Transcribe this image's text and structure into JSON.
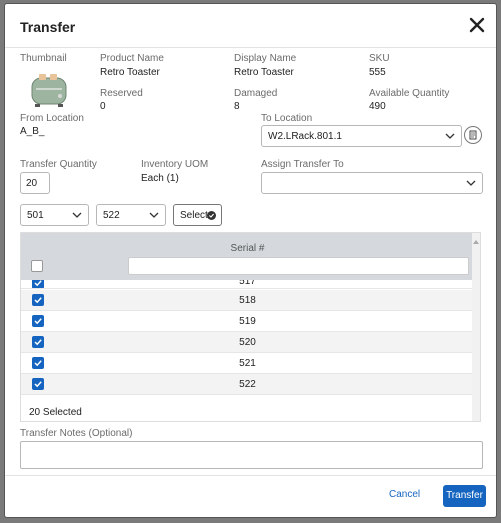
{
  "modal": {
    "title": "Transfer"
  },
  "product": {
    "thumbnail_label": "Thumbnail",
    "product_name_label": "Product Name",
    "product_name": "Retro Toaster",
    "display_name_label": "Display Name",
    "display_name": "Retro Toaster",
    "sku_label": "SKU",
    "sku": "555",
    "reserved_label": "Reserved",
    "reserved": "0",
    "damaged_label": "Damaged",
    "damaged": "8",
    "available_label": "Available Quantity",
    "available": "490"
  },
  "transfer": {
    "from_label": "From Location",
    "from_value": "A_B_",
    "to_label": "To Location",
    "to_value": "W2.LRack.801.1",
    "qty_label": "Transfer Quantity",
    "qty_value": "20",
    "uom_label": "Inventory UOM",
    "uom_value": "Each (1)",
    "assign_label": "Assign Transfer To",
    "assign_value": ""
  },
  "range": {
    "start": "501",
    "end": "522",
    "select_label": "Select"
  },
  "table": {
    "header_serial": "Serial #",
    "rows": [
      {
        "serial": "517"
      },
      {
        "serial": "518"
      },
      {
        "serial": "519"
      },
      {
        "serial": "520"
      },
      {
        "serial": "521"
      },
      {
        "serial": "522"
      }
    ],
    "selected_count": "20 Selected"
  },
  "notes": {
    "label": "Transfer Notes (Optional)",
    "value": ""
  },
  "footer": {
    "cancel_label": "Cancel",
    "transfer_label": "Transfer"
  },
  "colors": {
    "accent": "#1565c0",
    "header_bg": "#d5d9de"
  }
}
